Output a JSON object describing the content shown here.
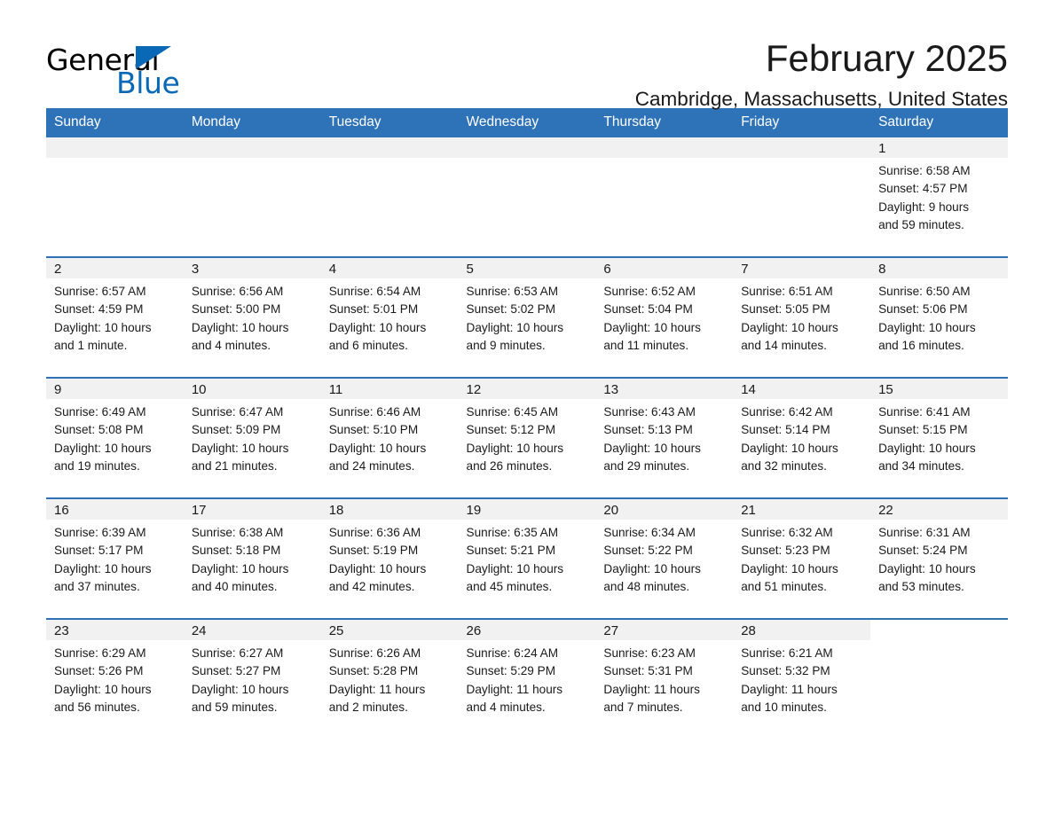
{
  "brand": {
    "name_part1": "General",
    "name_part2": "Blue",
    "accent_color": "#0a69b6"
  },
  "header": {
    "title": "February 2025",
    "subtitle": "Cambridge, Massachusetts, United States",
    "header_bar_color": "#2e72b8"
  },
  "weekdays": [
    "Sunday",
    "Monday",
    "Tuesday",
    "Wednesday",
    "Thursday",
    "Friday",
    "Saturday"
  ],
  "weeks": [
    [
      {
        "day": "",
        "sunrise": "",
        "sunset": "",
        "daylight_line1": "",
        "daylight_line2": ""
      },
      {
        "day": "",
        "sunrise": "",
        "sunset": "",
        "daylight_line1": "",
        "daylight_line2": ""
      },
      {
        "day": "",
        "sunrise": "",
        "sunset": "",
        "daylight_line1": "",
        "daylight_line2": ""
      },
      {
        "day": "",
        "sunrise": "",
        "sunset": "",
        "daylight_line1": "",
        "daylight_line2": ""
      },
      {
        "day": "",
        "sunrise": "",
        "sunset": "",
        "daylight_line1": "",
        "daylight_line2": ""
      },
      {
        "day": "",
        "sunrise": "",
        "sunset": "",
        "daylight_line1": "",
        "daylight_line2": ""
      },
      {
        "day": "1",
        "sunrise": "Sunrise: 6:58 AM",
        "sunset": "Sunset: 4:57 PM",
        "daylight_line1": "Daylight: 9 hours",
        "daylight_line2": "and 59 minutes."
      }
    ],
    [
      {
        "day": "2",
        "sunrise": "Sunrise: 6:57 AM",
        "sunset": "Sunset: 4:59 PM",
        "daylight_line1": "Daylight: 10 hours",
        "daylight_line2": "and 1 minute."
      },
      {
        "day": "3",
        "sunrise": "Sunrise: 6:56 AM",
        "sunset": "Sunset: 5:00 PM",
        "daylight_line1": "Daylight: 10 hours",
        "daylight_line2": "and 4 minutes."
      },
      {
        "day": "4",
        "sunrise": "Sunrise: 6:54 AM",
        "sunset": "Sunset: 5:01 PM",
        "daylight_line1": "Daylight: 10 hours",
        "daylight_line2": "and 6 minutes."
      },
      {
        "day": "5",
        "sunrise": "Sunrise: 6:53 AM",
        "sunset": "Sunset: 5:02 PM",
        "daylight_line1": "Daylight: 10 hours",
        "daylight_line2": "and 9 minutes."
      },
      {
        "day": "6",
        "sunrise": "Sunrise: 6:52 AM",
        "sunset": "Sunset: 5:04 PM",
        "daylight_line1": "Daylight: 10 hours",
        "daylight_line2": "and 11 minutes."
      },
      {
        "day": "7",
        "sunrise": "Sunrise: 6:51 AM",
        "sunset": "Sunset: 5:05 PM",
        "daylight_line1": "Daylight: 10 hours",
        "daylight_line2": "and 14 minutes."
      },
      {
        "day": "8",
        "sunrise": "Sunrise: 6:50 AM",
        "sunset": "Sunset: 5:06 PM",
        "daylight_line1": "Daylight: 10 hours",
        "daylight_line2": "and 16 minutes."
      }
    ],
    [
      {
        "day": "9",
        "sunrise": "Sunrise: 6:49 AM",
        "sunset": "Sunset: 5:08 PM",
        "daylight_line1": "Daylight: 10 hours",
        "daylight_line2": "and 19 minutes."
      },
      {
        "day": "10",
        "sunrise": "Sunrise: 6:47 AM",
        "sunset": "Sunset: 5:09 PM",
        "daylight_line1": "Daylight: 10 hours",
        "daylight_line2": "and 21 minutes."
      },
      {
        "day": "11",
        "sunrise": "Sunrise: 6:46 AM",
        "sunset": "Sunset: 5:10 PM",
        "daylight_line1": "Daylight: 10 hours",
        "daylight_line2": "and 24 minutes."
      },
      {
        "day": "12",
        "sunrise": "Sunrise: 6:45 AM",
        "sunset": "Sunset: 5:12 PM",
        "daylight_line1": "Daylight: 10 hours",
        "daylight_line2": "and 26 minutes."
      },
      {
        "day": "13",
        "sunrise": "Sunrise: 6:43 AM",
        "sunset": "Sunset: 5:13 PM",
        "daylight_line1": "Daylight: 10 hours",
        "daylight_line2": "and 29 minutes."
      },
      {
        "day": "14",
        "sunrise": "Sunrise: 6:42 AM",
        "sunset": "Sunset: 5:14 PM",
        "daylight_line1": "Daylight: 10 hours",
        "daylight_line2": "and 32 minutes."
      },
      {
        "day": "15",
        "sunrise": "Sunrise: 6:41 AM",
        "sunset": "Sunset: 5:15 PM",
        "daylight_line1": "Daylight: 10 hours",
        "daylight_line2": "and 34 minutes."
      }
    ],
    [
      {
        "day": "16",
        "sunrise": "Sunrise: 6:39 AM",
        "sunset": "Sunset: 5:17 PM",
        "daylight_line1": "Daylight: 10 hours",
        "daylight_line2": "and 37 minutes."
      },
      {
        "day": "17",
        "sunrise": "Sunrise: 6:38 AM",
        "sunset": "Sunset: 5:18 PM",
        "daylight_line1": "Daylight: 10 hours",
        "daylight_line2": "and 40 minutes."
      },
      {
        "day": "18",
        "sunrise": "Sunrise: 6:36 AM",
        "sunset": "Sunset: 5:19 PM",
        "daylight_line1": "Daylight: 10 hours",
        "daylight_line2": "and 42 minutes."
      },
      {
        "day": "19",
        "sunrise": "Sunrise: 6:35 AM",
        "sunset": "Sunset: 5:21 PM",
        "daylight_line1": "Daylight: 10 hours",
        "daylight_line2": "and 45 minutes."
      },
      {
        "day": "20",
        "sunrise": "Sunrise: 6:34 AM",
        "sunset": "Sunset: 5:22 PM",
        "daylight_line1": "Daylight: 10 hours",
        "daylight_line2": "and 48 minutes."
      },
      {
        "day": "21",
        "sunrise": "Sunrise: 6:32 AM",
        "sunset": "Sunset: 5:23 PM",
        "daylight_line1": "Daylight: 10 hours",
        "daylight_line2": "and 51 minutes."
      },
      {
        "day": "22",
        "sunrise": "Sunrise: 6:31 AM",
        "sunset": "Sunset: 5:24 PM",
        "daylight_line1": "Daylight: 10 hours",
        "daylight_line2": "and 53 minutes."
      }
    ],
    [
      {
        "day": "23",
        "sunrise": "Sunrise: 6:29 AM",
        "sunset": "Sunset: 5:26 PM",
        "daylight_line1": "Daylight: 10 hours",
        "daylight_line2": "and 56 minutes."
      },
      {
        "day": "24",
        "sunrise": "Sunrise: 6:27 AM",
        "sunset": "Sunset: 5:27 PM",
        "daylight_line1": "Daylight: 10 hours",
        "daylight_line2": "and 59 minutes."
      },
      {
        "day": "25",
        "sunrise": "Sunrise: 6:26 AM",
        "sunset": "Sunset: 5:28 PM",
        "daylight_line1": "Daylight: 11 hours",
        "daylight_line2": "and 2 minutes."
      },
      {
        "day": "26",
        "sunrise": "Sunrise: 6:24 AM",
        "sunset": "Sunset: 5:29 PM",
        "daylight_line1": "Daylight: 11 hours",
        "daylight_line2": "and 4 minutes."
      },
      {
        "day": "27",
        "sunrise": "Sunrise: 6:23 AM",
        "sunset": "Sunset: 5:31 PM",
        "daylight_line1": "Daylight: 11 hours",
        "daylight_line2": "and 7 minutes."
      },
      {
        "day": "28",
        "sunrise": "Sunrise: 6:21 AM",
        "sunset": "Sunset: 5:32 PM",
        "daylight_line1": "Daylight: 11 hours",
        "daylight_line2": "and 10 minutes."
      },
      {
        "day": "",
        "sunrise": "",
        "sunset": "",
        "daylight_line1": "",
        "daylight_line2": ""
      }
    ]
  ]
}
